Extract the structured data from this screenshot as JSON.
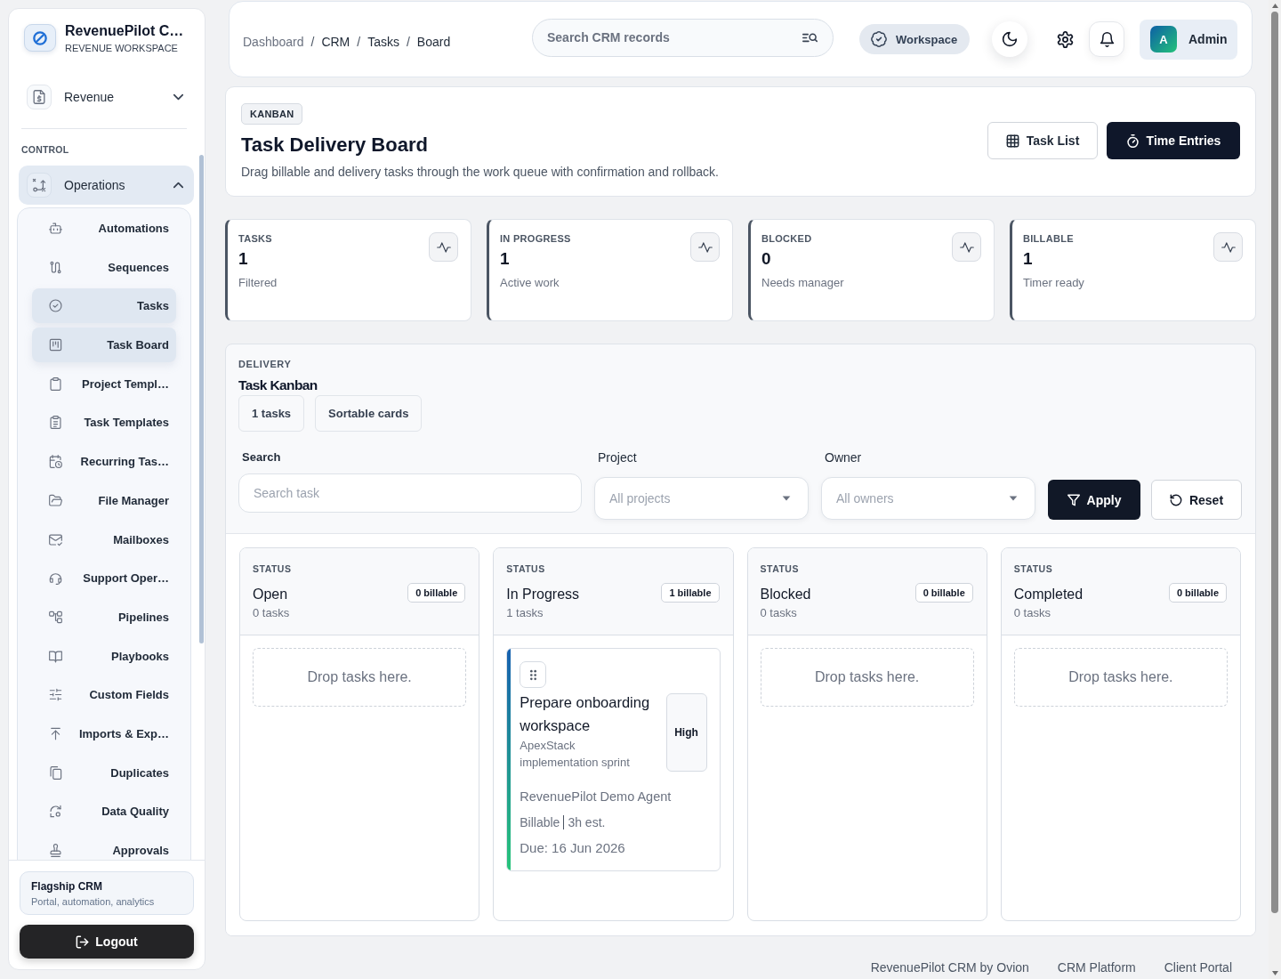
{
  "sidebar": {
    "brand": {
      "title": "RevenuePilot C…",
      "subtitle": "REVENUE WORKSPACE"
    },
    "top_groups": [
      {
        "label": "Revenue",
        "expanded": false
      }
    ],
    "section_label": "CONTROL",
    "section_groups": [
      {
        "label": "Operations",
        "expanded": true,
        "items": [
          {
            "label": "Automations",
            "selected": false
          },
          {
            "label": "Sequences",
            "selected": false
          },
          {
            "label": "Tasks",
            "selected": true
          },
          {
            "label": "Task Board",
            "selected": true
          },
          {
            "label": "Project Templ…",
            "selected": false
          },
          {
            "label": "Task Templates",
            "selected": false
          },
          {
            "label": "Recurring Tas…",
            "selected": false
          },
          {
            "label": "File Manager",
            "selected": false
          },
          {
            "label": "Mailboxes",
            "selected": false
          },
          {
            "label": "Support Oper…",
            "selected": false
          },
          {
            "label": "Pipelines",
            "selected": false
          },
          {
            "label": "Playbooks",
            "selected": false
          },
          {
            "label": "Custom Fields",
            "selected": false
          },
          {
            "label": "Imports & Exp…",
            "selected": false
          },
          {
            "label": "Duplicates",
            "selected": false
          },
          {
            "label": "Data Quality",
            "selected": false
          },
          {
            "label": "Approvals",
            "selected": false
          }
        ]
      }
    ],
    "footer_card": {
      "title": "Flagship CRM",
      "subtitle": "Portal, automation, analytics"
    },
    "logout_button": "Logout"
  },
  "header": {
    "breadcrumb": {
      "items": [
        "Dashboard",
        "CRM",
        "Tasks",
        "Board"
      ],
      "separator": "/"
    },
    "search": {
      "placeholder": "Search CRM records"
    },
    "workspace_button": "Workspace",
    "user": {
      "initial": "A",
      "name": "Admin"
    }
  },
  "page_header": {
    "tag": "KANBAN",
    "title": "Task Delivery Board",
    "description": "Drag billable and delivery tasks through the work queue with confirmation and rollback.",
    "buttons": [
      {
        "label": "Task List",
        "kind": "secondary"
      },
      {
        "label": "Time Entries",
        "kind": "primary"
      }
    ]
  },
  "stats": [
    {
      "label": "TASKS",
      "value": "1",
      "note": "Filtered"
    },
    {
      "label": "IN PROGRESS",
      "value": "1",
      "note": "Active work"
    },
    {
      "label": "BLOCKED",
      "value": "0",
      "note": "Needs manager"
    },
    {
      "label": "BILLABLE",
      "value": "1",
      "note": "Timer ready"
    }
  ],
  "kanban": {
    "eyebrow": "DELIVERY",
    "title": "Task Kanban",
    "chips": [
      "1 tasks",
      "Sortable cards"
    ],
    "filters": [
      {
        "kind": "text",
        "label": "Search",
        "placeholder": "Search task"
      },
      {
        "kind": "select",
        "label": "Project",
        "placeholder": "All projects"
      },
      {
        "kind": "select",
        "label": "Owner",
        "placeholder": "All owners"
      }
    ],
    "actions": [
      {
        "label": "Apply",
        "kind": "primary"
      },
      {
        "label": "Reset",
        "kind": "secondary"
      }
    ],
    "columns": [
      {
        "eyebrow": "STATUS",
        "name": "Open",
        "count": "0 tasks",
        "billable": "0 billable",
        "empty_text": "Drop tasks here."
      },
      {
        "eyebrow": "STATUS",
        "name": "In Progress",
        "count": "1 tasks",
        "billable": "1 billable",
        "cards": [
          {
            "title": "Prepare onboarding workspace",
            "project": "ApexStack implementation sprint",
            "priority": "High",
            "owner": "RevenuePilot Demo Agent",
            "billing": "Billable",
            "estimate": "3h est.",
            "due": "Due: 16 Jun 2026"
          }
        ]
      },
      {
        "eyebrow": "STATUS",
        "name": "Blocked",
        "count": "0 tasks",
        "billable": "0 billable",
        "empty_text": "Drop tasks here."
      },
      {
        "eyebrow": "STATUS",
        "name": "Completed",
        "count": "0 tasks",
        "billable": "0 billable",
        "empty_text": "Drop tasks here."
      }
    ]
  },
  "footer": {
    "links": [
      "RevenuePilot CRM by Ovion",
      "CRM Platform",
      "Client Portal"
    ]
  }
}
